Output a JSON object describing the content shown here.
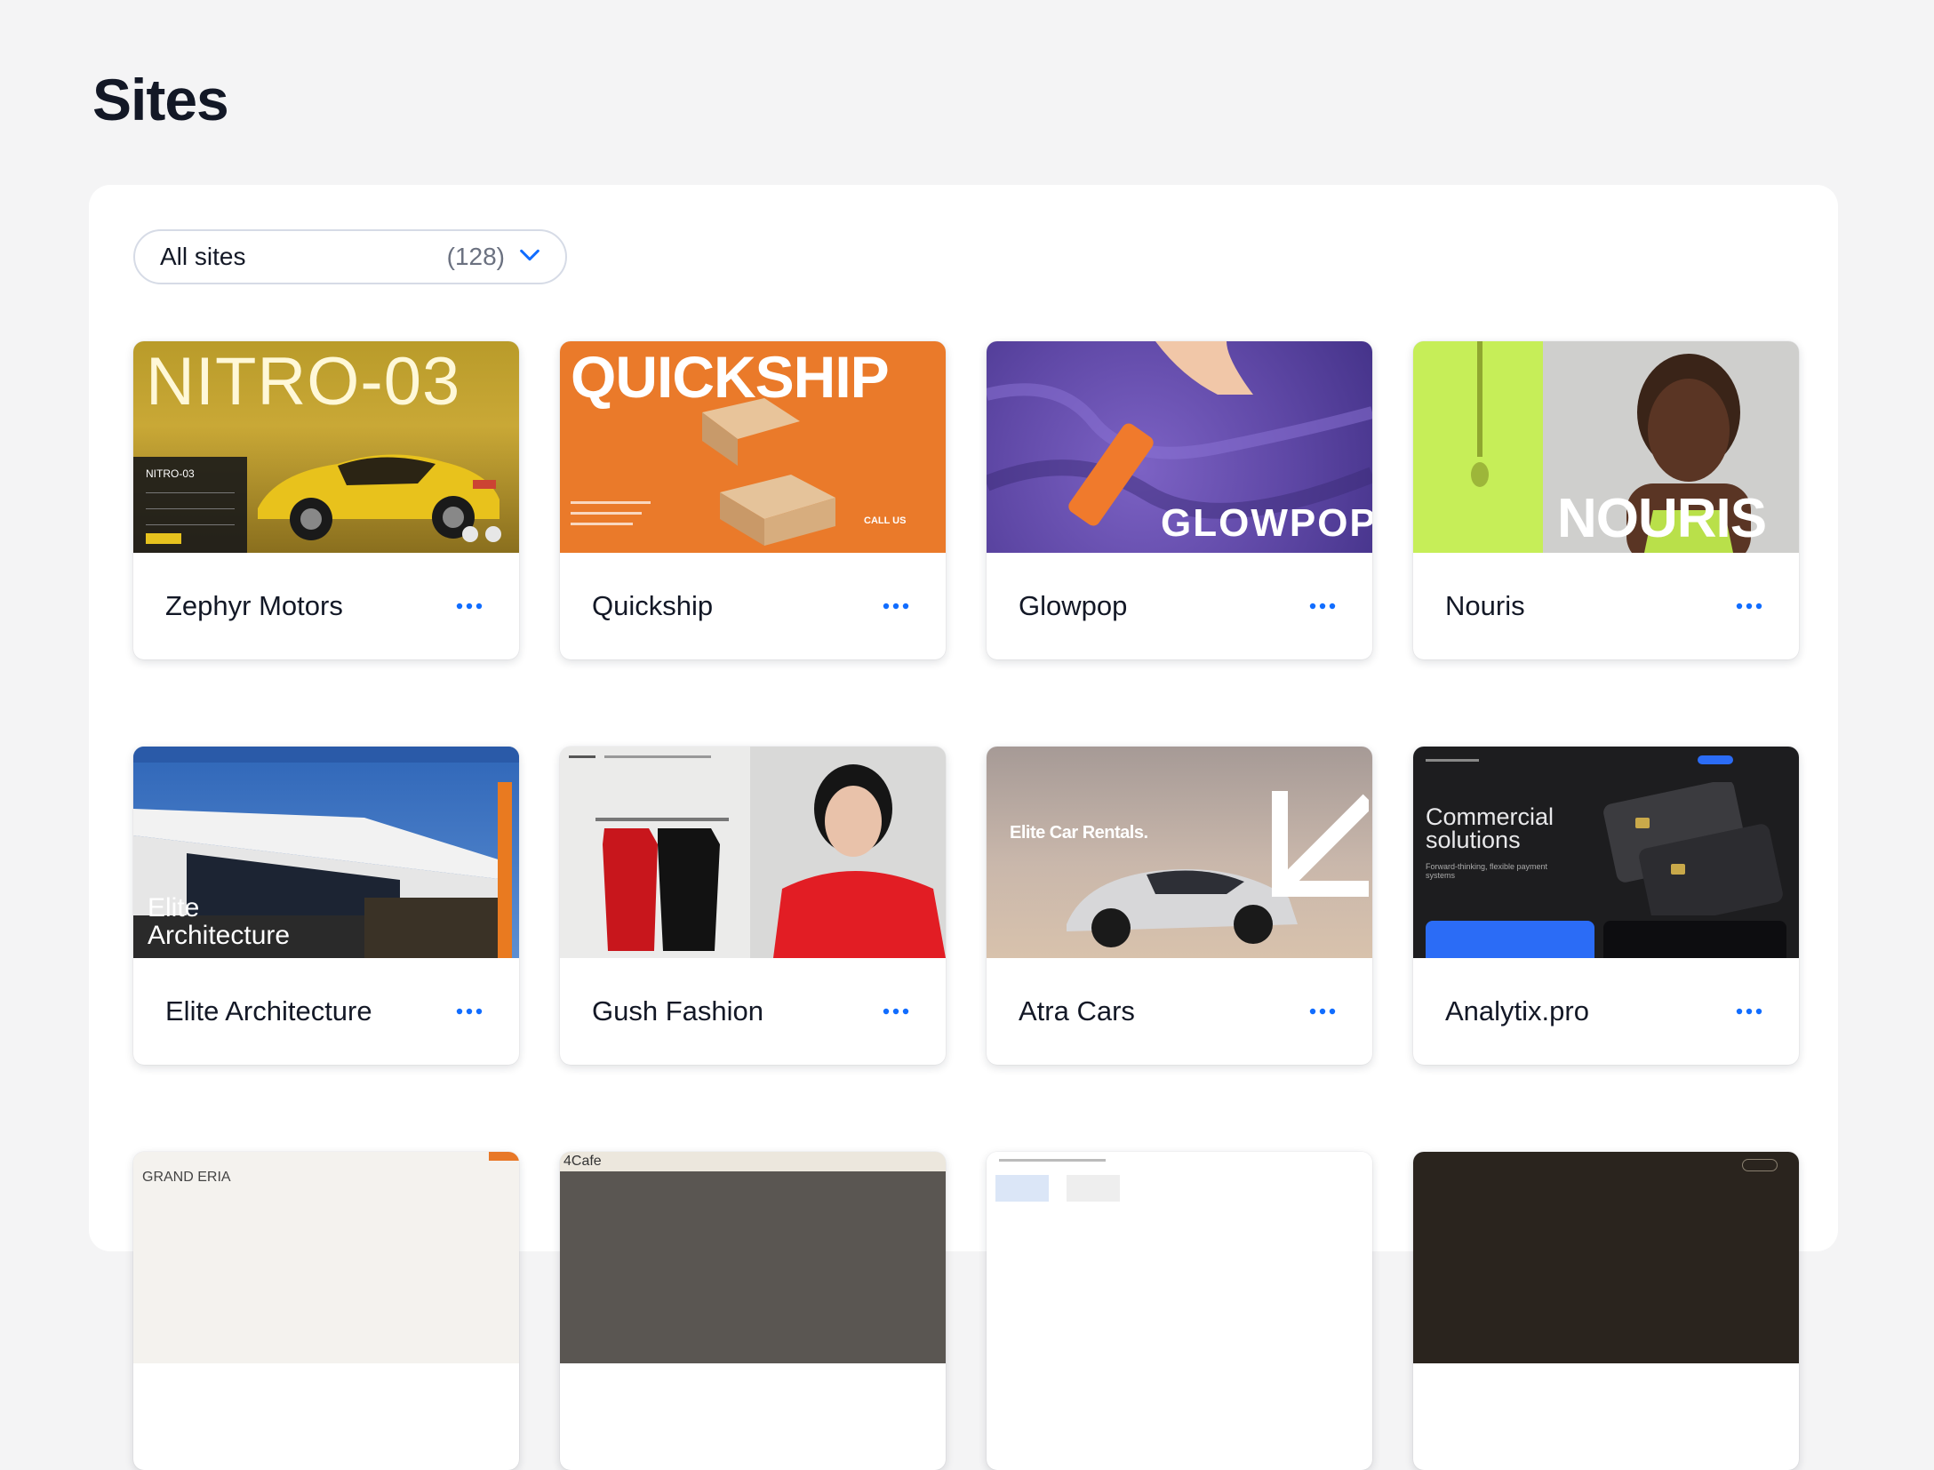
{
  "page": {
    "title": "Sites"
  },
  "filter": {
    "label": "All sites",
    "count": "(128)"
  },
  "colors": {
    "accent": "#116dff",
    "background": "#f4f4f5",
    "panel": "#ffffff"
  },
  "sites": [
    {
      "name": "Zephyr Motors",
      "thumb_title": "NITRO-03",
      "thumb_sub": "NITRO-03"
    },
    {
      "name": "Quickship",
      "thumb_title": "QUICKSHIP",
      "thumb_sub": "CALL US"
    },
    {
      "name": "Glowpop",
      "thumb_title": "GLOWPOP"
    },
    {
      "name": "Nouris",
      "thumb_title": "NOURIS"
    },
    {
      "name": "Elite Architecture",
      "thumb_title": "Elite Architecture"
    },
    {
      "name": "Gush Fashion"
    },
    {
      "name": "Atra Cars",
      "thumb_title": "Elite Car Rentals."
    },
    {
      "name": "Analytix.pro",
      "thumb_title": "Commercial solutions",
      "thumb_sub": "Forward-thinking, flexible payment systems"
    }
  ],
  "partial_row": [
    {
      "thumb_title": "GRAND ERIA"
    },
    {
      "thumb_title": "4Cafe"
    },
    {
      "thumb_title": ""
    },
    {
      "thumb_title": ""
    }
  ]
}
